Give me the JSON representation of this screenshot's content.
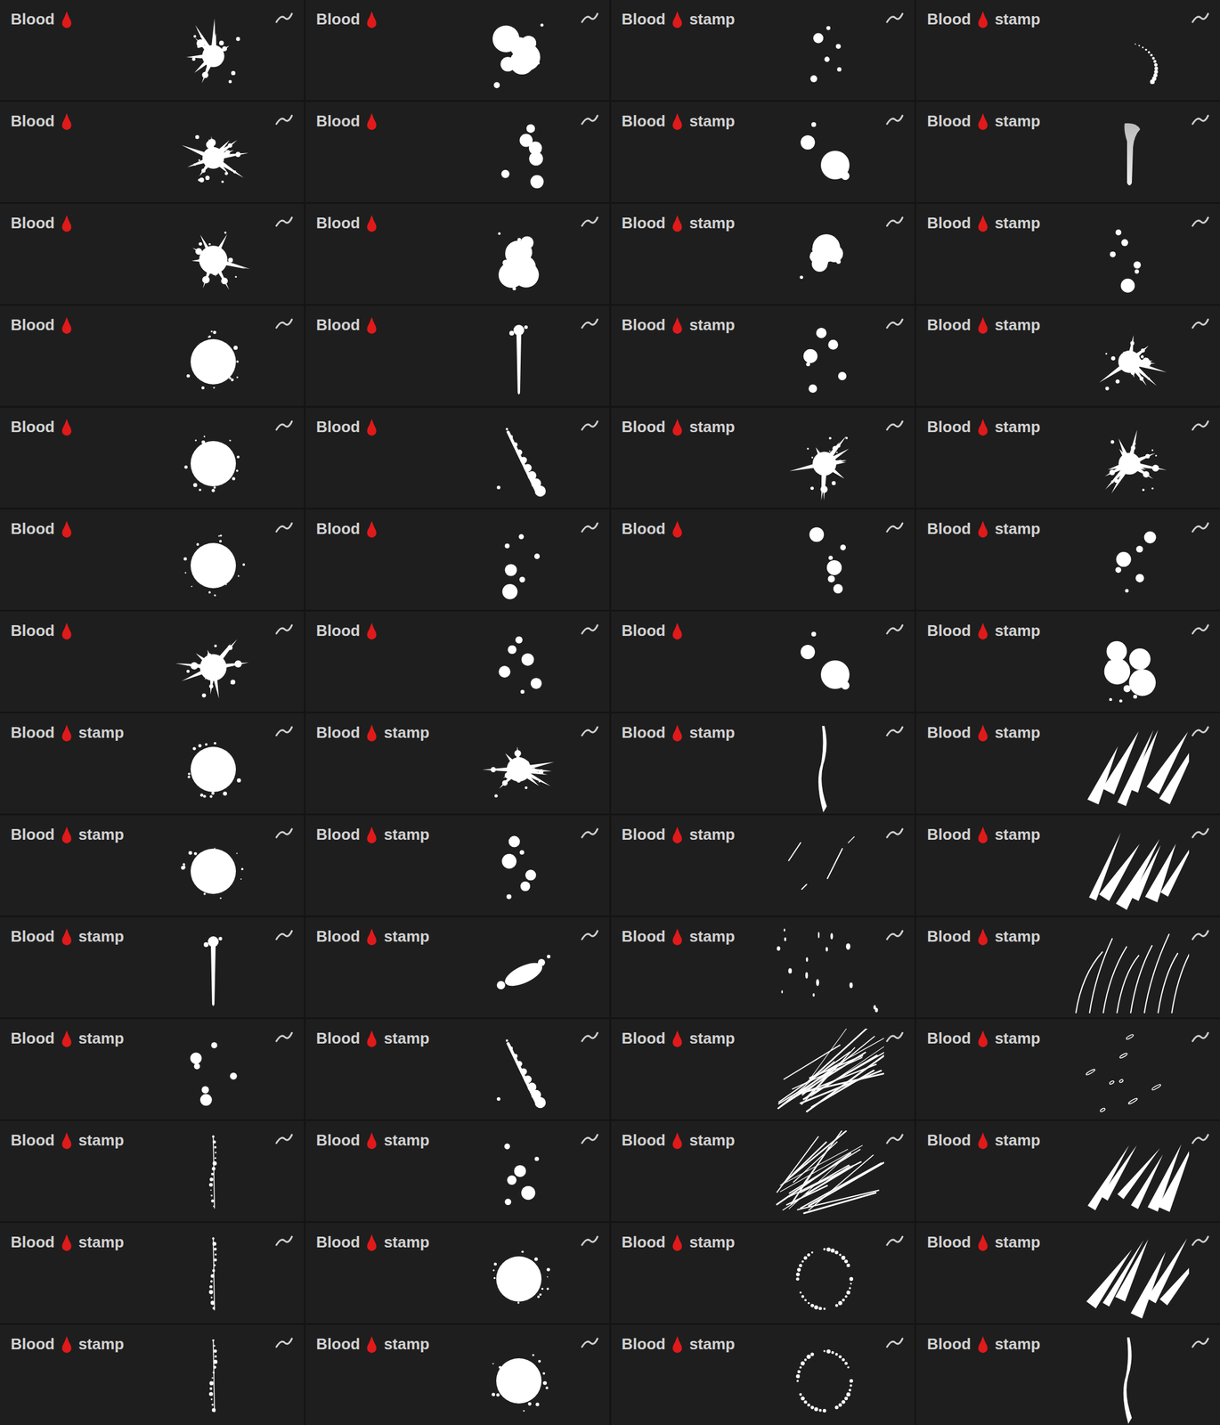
{
  "tiles": [
    {
      "label": "Blood",
      "kind": "splatter"
    },
    {
      "label": "Blood",
      "kind": "blobs"
    },
    {
      "label": "Blood",
      "suffix": "stamp",
      "kind": "dots"
    },
    {
      "label": "Blood",
      "suffix": "stamp",
      "kind": "arc"
    },
    {
      "label": "Blood",
      "kind": "splatter"
    },
    {
      "label": "Blood",
      "kind": "dots"
    },
    {
      "label": "Blood",
      "suffix": "stamp",
      "kind": "drops"
    },
    {
      "label": "Blood",
      "suffix": "stamp",
      "kind": "softdrip"
    },
    {
      "label": "Blood",
      "kind": "splatter"
    },
    {
      "label": "Blood",
      "kind": "blobs"
    },
    {
      "label": "Blood",
      "suffix": "stamp",
      "kind": "blobs"
    },
    {
      "label": "Blood",
      "suffix": "stamp",
      "kind": "dots"
    },
    {
      "label": "Blood",
      "kind": "round"
    },
    {
      "label": "Blood",
      "kind": "drip"
    },
    {
      "label": "Blood",
      "suffix": "stamp",
      "kind": "dots"
    },
    {
      "label": "Blood",
      "suffix": "stamp",
      "kind": "splatter"
    },
    {
      "label": "Blood",
      "kind": "round"
    },
    {
      "label": "Blood",
      "kind": "trail"
    },
    {
      "label": "Blood",
      "suffix": "stamp",
      "kind": "splatter"
    },
    {
      "label": "Blood",
      "suffix": "stamp",
      "kind": "splatter"
    },
    {
      "label": "Blood",
      "kind": "round"
    },
    {
      "label": "Blood",
      "kind": "dots"
    },
    {
      "label": "Blood",
      "kind": "dots"
    },
    {
      "label": "Blood",
      "suffix": "stamp",
      "kind": "dots"
    },
    {
      "label": "Blood",
      "kind": "splatter"
    },
    {
      "label": "Blood",
      "kind": "dots"
    },
    {
      "label": "Blood",
      "kind": "drops"
    },
    {
      "label": "Blood",
      "suffix": "stamp",
      "kind": "blobs"
    },
    {
      "label": "Blood",
      "suffix": "stamp",
      "kind": "round"
    },
    {
      "label": "Blood",
      "suffix": "stamp",
      "kind": "splatter"
    },
    {
      "label": "Blood",
      "suffix": "stamp",
      "kind": "vein"
    },
    {
      "label": "Blood",
      "suffix": "stamp",
      "kind": "claw"
    },
    {
      "label": "Blood",
      "suffix": "stamp",
      "kind": "round"
    },
    {
      "label": "Blood",
      "suffix": "stamp",
      "kind": "dots"
    },
    {
      "label": "Blood",
      "suffix": "stamp",
      "kind": "scratches"
    },
    {
      "label": "Blood",
      "suffix": "stamp",
      "kind": "claw"
    },
    {
      "label": "Blood",
      "suffix": "stamp",
      "kind": "drip"
    },
    {
      "label": "Blood",
      "suffix": "stamp",
      "kind": "smear"
    },
    {
      "label": "Blood",
      "suffix": "stamp",
      "kind": "specks"
    },
    {
      "label": "Blood",
      "suffix": "stamp",
      "kind": "streaks"
    },
    {
      "label": "Blood",
      "suffix": "stamp",
      "kind": "dots"
    },
    {
      "label": "Blood",
      "suffix": "stamp",
      "kind": "trail"
    },
    {
      "label": "Blood",
      "suffix": "stamp",
      "kind": "spray"
    },
    {
      "label": "Blood",
      "suffix": "stamp",
      "kind": "ovals"
    },
    {
      "label": "Blood",
      "suffix": "stamp",
      "kind": "line"
    },
    {
      "label": "Blood",
      "suffix": "stamp",
      "kind": "dots"
    },
    {
      "label": "Blood",
      "suffix": "stamp",
      "kind": "spray"
    },
    {
      "label": "Blood",
      "suffix": "stamp",
      "kind": "claw"
    },
    {
      "label": "Blood",
      "suffix": "stamp",
      "kind": "line"
    },
    {
      "label": "Blood",
      "suffix": "stamp",
      "kind": "round"
    },
    {
      "label": "Blood",
      "suffix": "stamp",
      "kind": "ring"
    },
    {
      "label": "Blood",
      "suffix": "stamp",
      "kind": "claw"
    },
    {
      "label": "Blood",
      "suffix": "stamp",
      "kind": "line"
    },
    {
      "label": "Blood",
      "suffix": "stamp",
      "kind": "round"
    },
    {
      "label": "Blood",
      "suffix": "stamp",
      "kind": "ring"
    },
    {
      "label": "Blood",
      "suffix": "stamp",
      "kind": "vein"
    }
  ]
}
